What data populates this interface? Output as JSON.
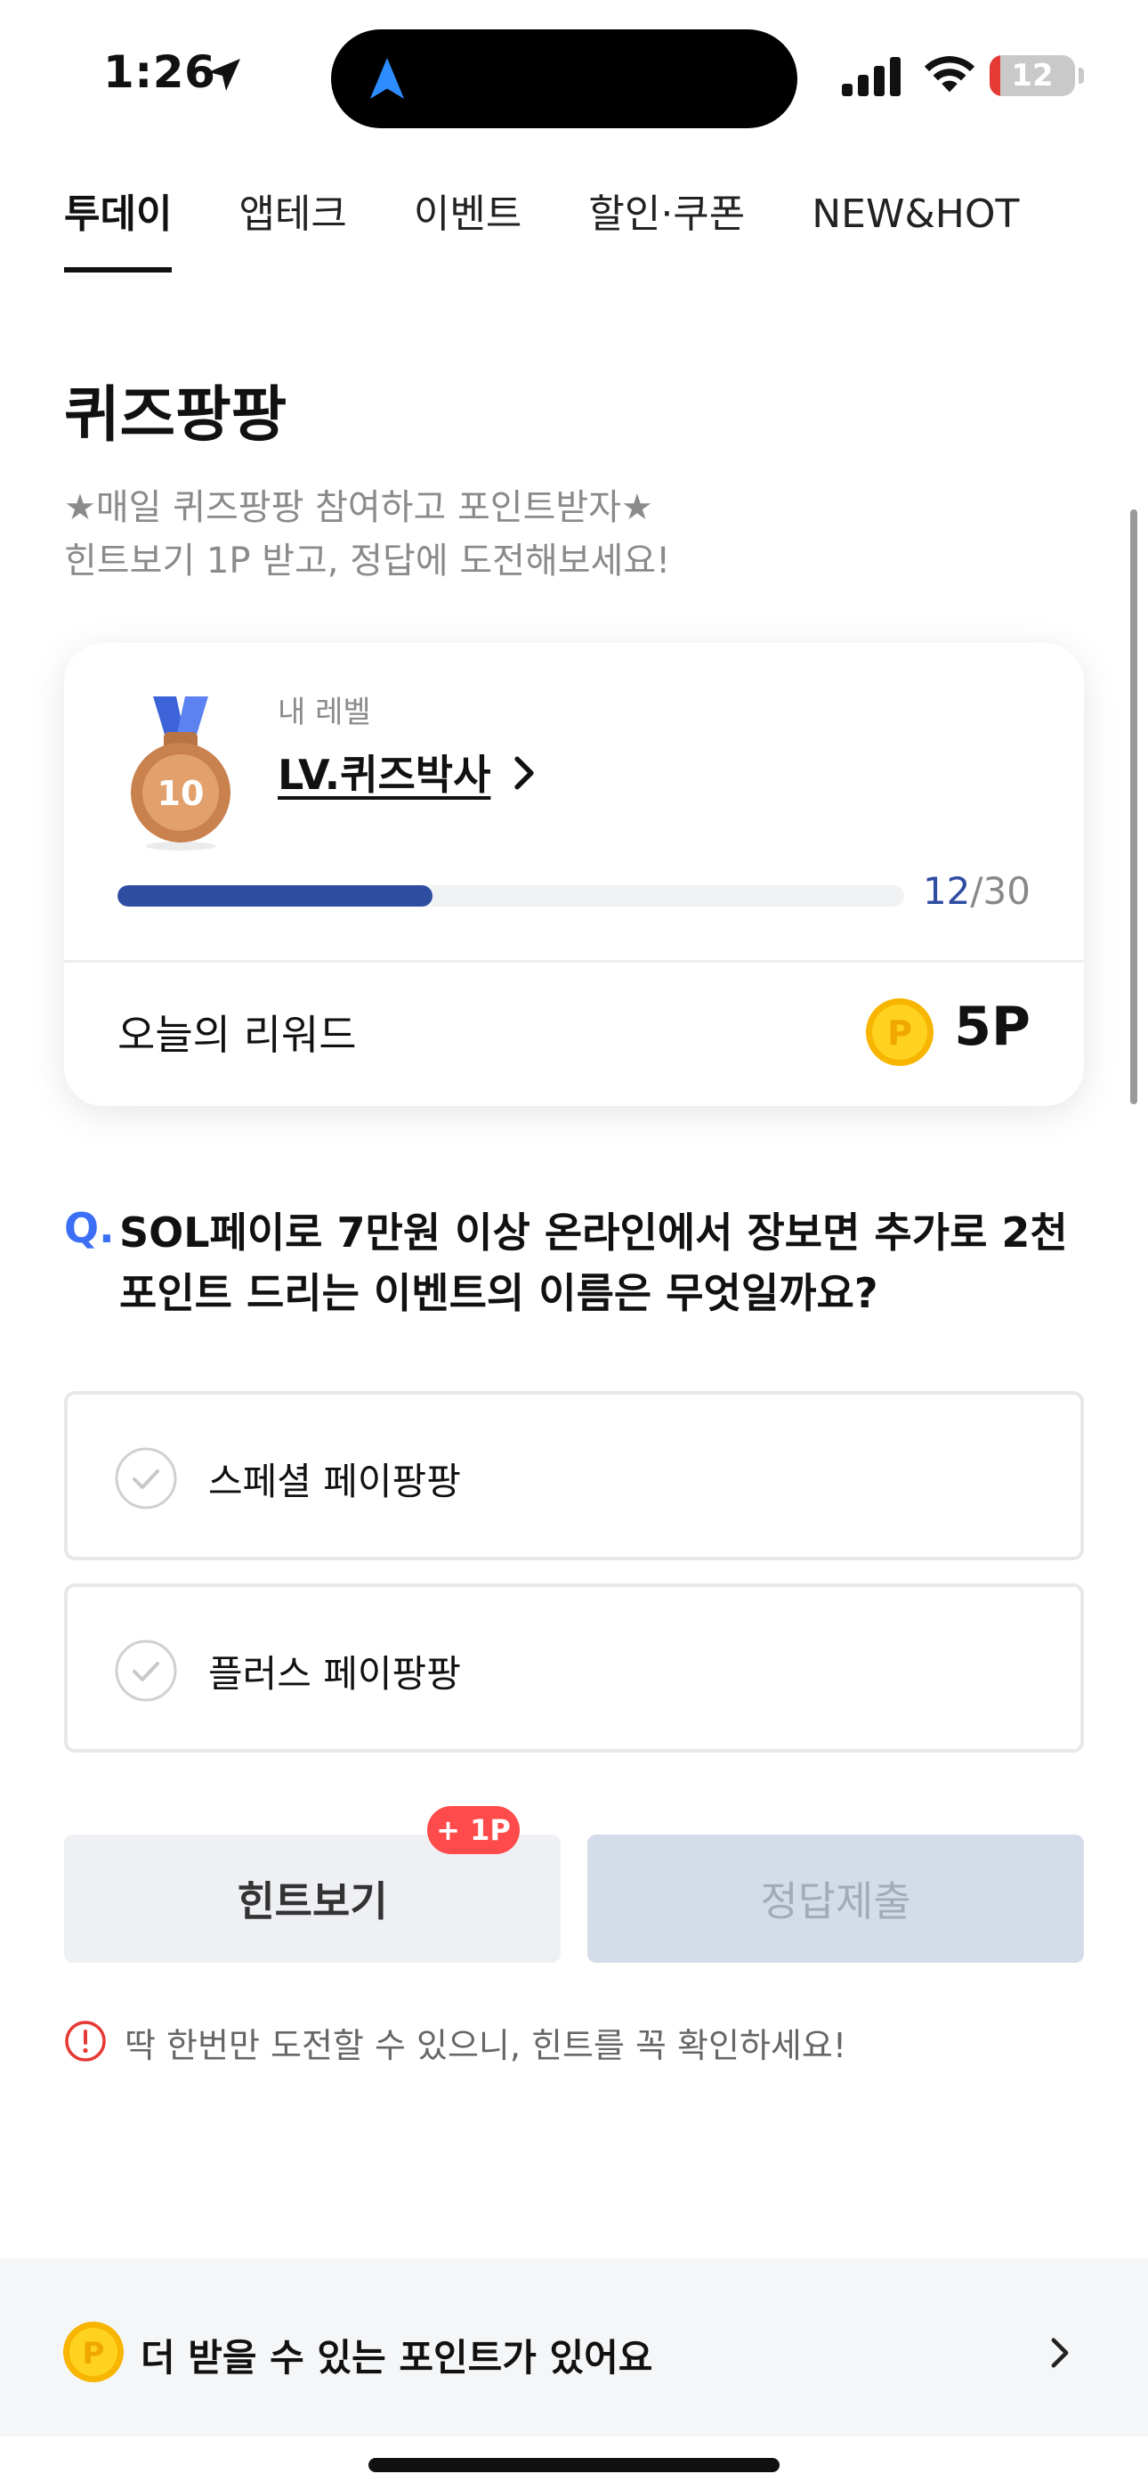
{
  "status_bar": {
    "time": "1:26",
    "battery_level": "12",
    "battery_fraction": 0.12,
    "icons": [
      "location-arrow-icon",
      "navigation-icon",
      "cellular-signal-icon",
      "wifi-icon",
      "battery-icon"
    ]
  },
  "tabs": [
    {
      "label": "투데이",
      "active": true
    },
    {
      "label": "앱테크",
      "active": false
    },
    {
      "label": "이벤트",
      "active": false
    },
    {
      "label": "할인·쿠폰",
      "active": false
    },
    {
      "label": "NEW&HOT",
      "active": false
    }
  ],
  "page": {
    "title": "퀴즈팡팡",
    "subtitle_line1": "★매일 퀴즈팡팡 참여하고 포인트받자★",
    "subtitle_line2": "힌트보기 1P 받고, 정답에 도전해보세요!"
  },
  "level_card": {
    "medal_number": "10",
    "caption": "내 레벨",
    "level_name": "LV.퀴즈박사",
    "progress_current": "12",
    "progress_total": "/30",
    "progress_fraction": 0.4,
    "reward_label": "오늘의 리워드",
    "reward_coin_letter": "P",
    "reward_value": "5P"
  },
  "question": {
    "prefix": "Q.",
    "text": "SOL페이로 7만원 이상 온라인에서 장보면 추가로 2천 포인트 드리는 이벤트의 이름은 무엇일까요?",
    "options": [
      {
        "label": "스페셜 페이팡팡"
      },
      {
        "label": "플러스 페이팡팡"
      }
    ]
  },
  "actions": {
    "hint_label": "힌트보기",
    "hint_badge": "+ 1P",
    "submit_label": "정답제출",
    "warning": "딱 한번만 도전할 수 있으니, 힌트를 꼭 확인하세요!"
  },
  "banner": {
    "coin_letter": "P",
    "text": "더 받을 수 있는 포인트가 있어요"
  },
  "colors": {
    "accent_blue": "#2f4da1",
    "question_blue": "#3b6ff5",
    "badge_red": "#ff4b4b",
    "coin_gold": "#ffc400",
    "medal_bronze": "#c9814e"
  }
}
